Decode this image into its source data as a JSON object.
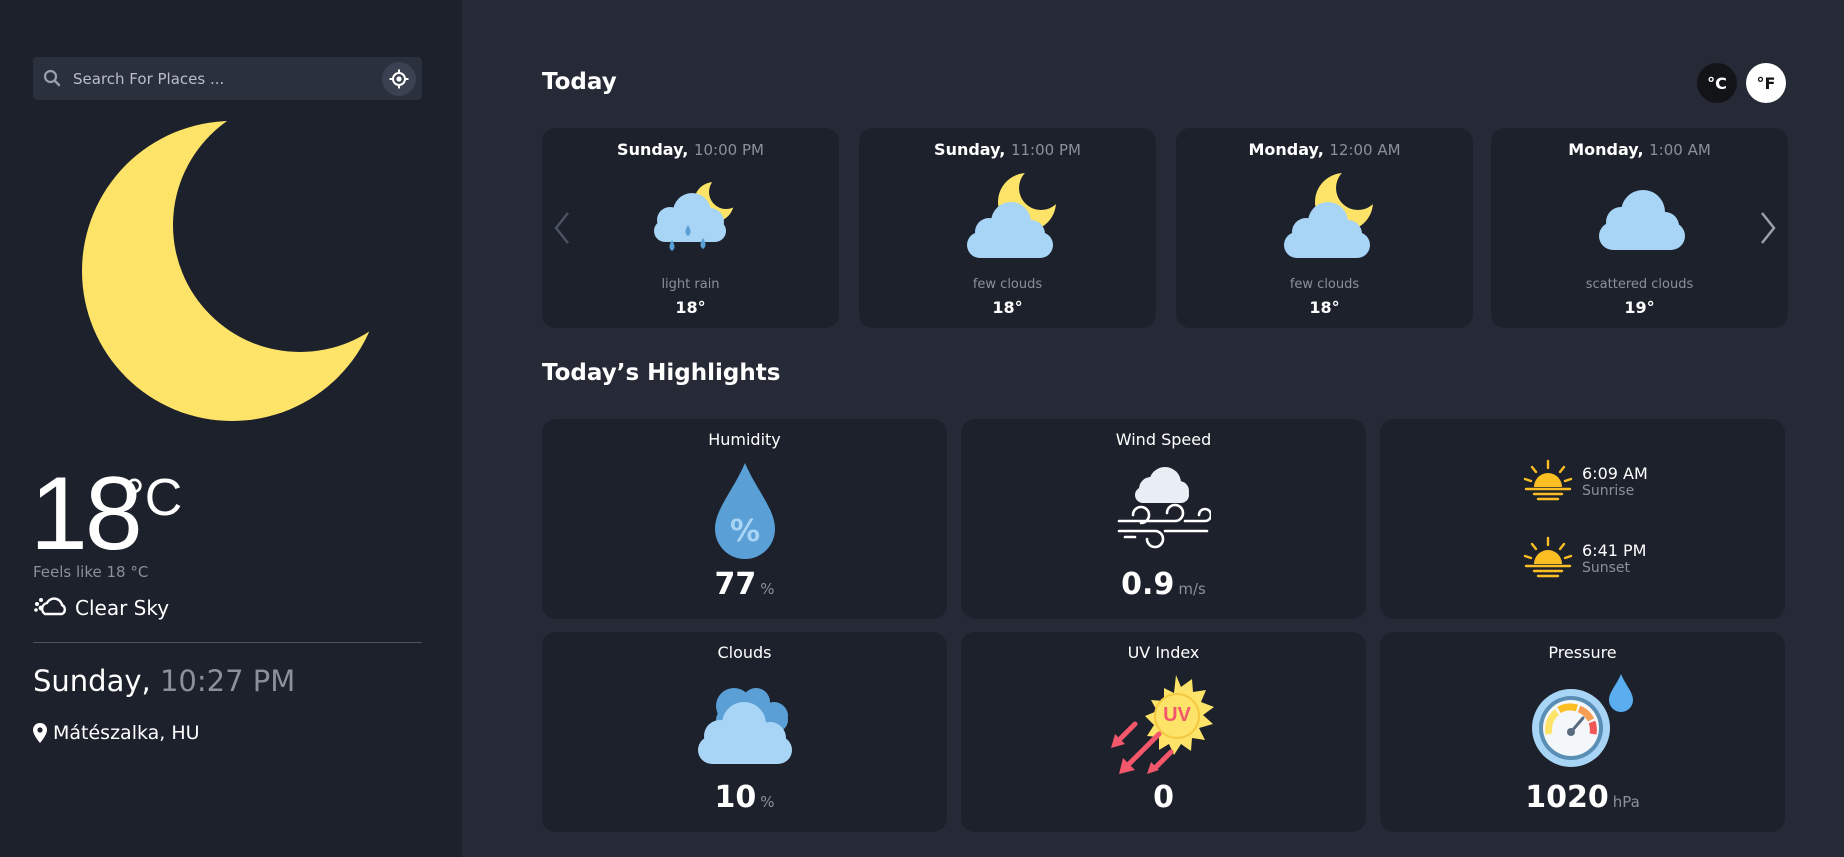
{
  "search": {
    "placeholder": "Search For Places ..."
  },
  "current": {
    "temp": "18",
    "unit": "°C",
    "feels_like": "Feels like 18 °C",
    "condition": "Clear Sky",
    "day": "Sunday,",
    "time": "10:27 PM",
    "location": "Mátészalka, HU"
  },
  "today": {
    "title": "Today",
    "unit_c": "°C",
    "unit_f": "°F",
    "forecast": [
      {
        "day": "Sunday,",
        "time": "10:00 PM",
        "desc": "light rain",
        "temp": "18°",
        "icon": "moon-cloud-rain-icon"
      },
      {
        "day": "Sunday,",
        "time": "11:00 PM",
        "desc": "few clouds",
        "temp": "18°",
        "icon": "moon-cloud-icon"
      },
      {
        "day": "Monday,",
        "time": "12:00 AM",
        "desc": "few clouds",
        "temp": "18°",
        "icon": "moon-cloud-icon"
      },
      {
        "day": "Monday,",
        "time": "1:00 AM",
        "desc": "scattered clouds",
        "temp": "19°",
        "icon": "cloud-icon"
      }
    ]
  },
  "highlights": {
    "title": "Today’s Highlights",
    "humidity": {
      "label": "Humidity",
      "value": "77",
      "unit": "%"
    },
    "wind": {
      "label": "Wind Speed",
      "value": "0.9",
      "unit": "m/s"
    },
    "sunrise": {
      "time": "6:09 AM",
      "label": "Sunrise"
    },
    "sunset": {
      "time": "6:41 PM",
      "label": "Sunset"
    },
    "clouds": {
      "label": "Clouds",
      "value": "10",
      "unit": "%"
    },
    "uv": {
      "label": "UV Index",
      "value": "0",
      "badge": "UV"
    },
    "pressure": {
      "label": "Pressure",
      "value": "1020",
      "unit": "hPa"
    }
  },
  "colors": {
    "background": "#252a36",
    "panel": "#1c212c",
    "moon": "#fde469",
    "cloud": "#a8d4f5",
    "muted": "#8a909c"
  }
}
